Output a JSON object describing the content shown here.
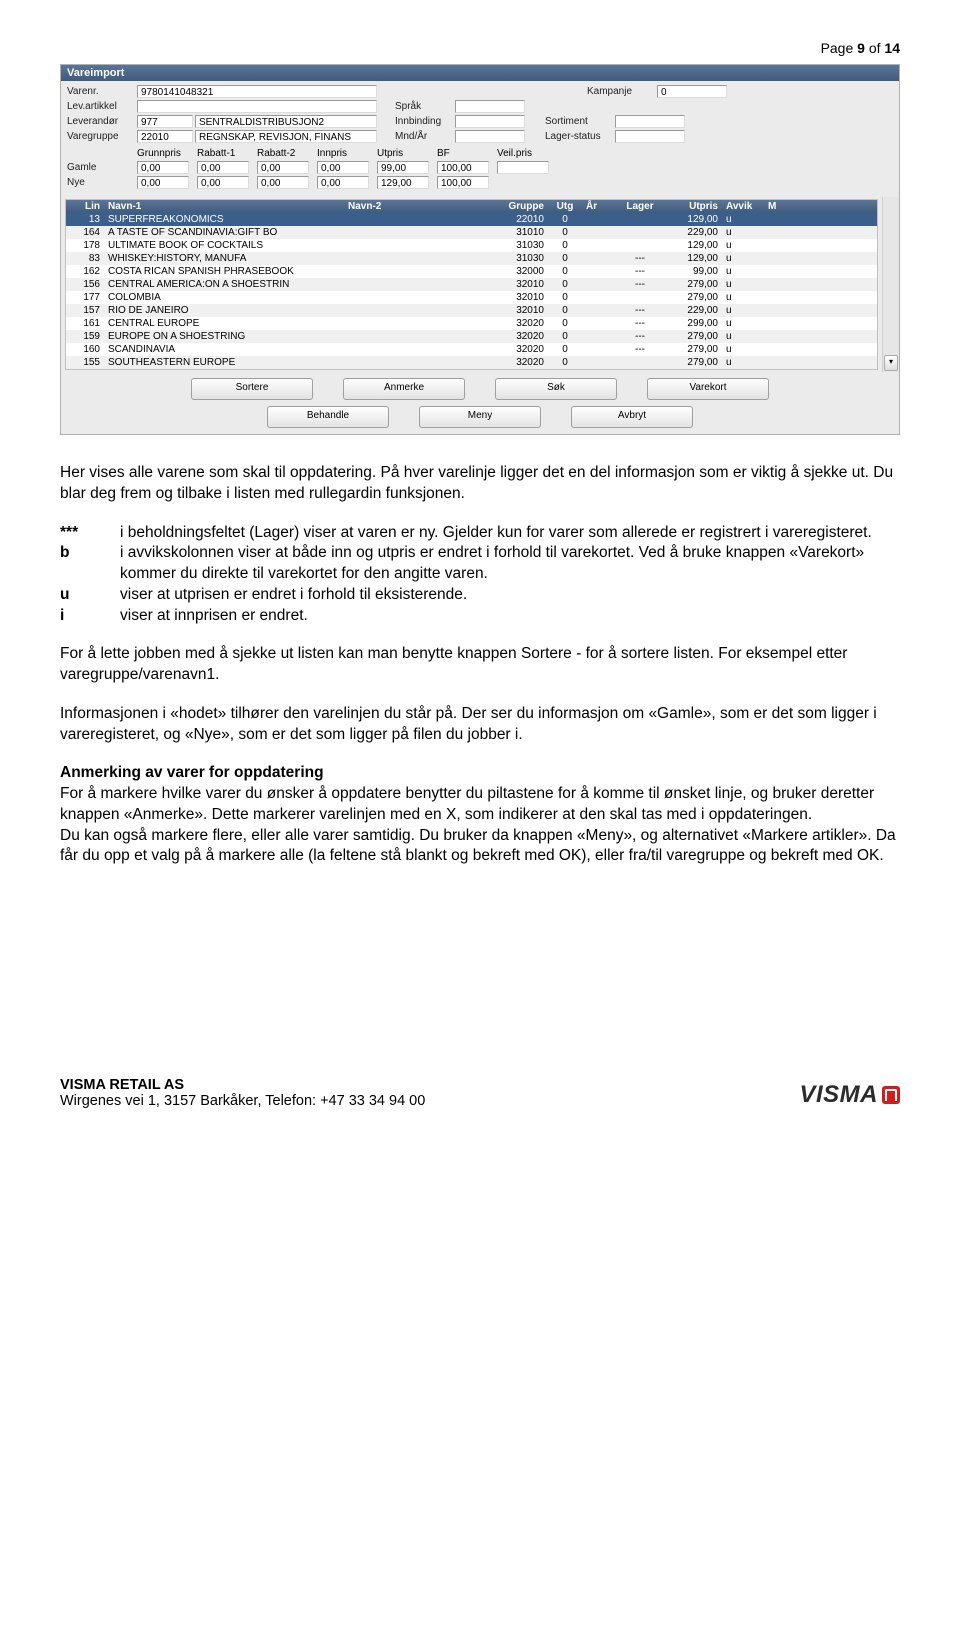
{
  "page_number": {
    "prefix": "Page ",
    "current": "9",
    "of": " of ",
    "total": "14"
  },
  "app": {
    "title": "Vareimport",
    "form": {
      "varenr_lbl": "Varenr.",
      "varenr": "9780141048321",
      "levart_lbl": "Lev.artikkel",
      "levart": "",
      "lever_lbl": "Leverandør",
      "lever_code": "977",
      "lever_name": "SENTRALDISTRIBUSJON2",
      "vgr_lbl": "Varegruppe",
      "vgr_code": "22010",
      "vgr_name": "REGNSKAP, REVISJON, FINANS",
      "sprak_lbl": "Språk",
      "sprak": "",
      "innb_lbl": "Innbinding",
      "innb": "",
      "mndar_lbl": "Mnd/År",
      "mndar": "",
      "kamp_lbl": "Kampanje",
      "kamp": "0",
      "sort_lbl": "Sortiment",
      "sort": "",
      "lager_lbl": "Lager-status",
      "lager": ""
    },
    "price_headers": [
      "Grunnpris",
      "Rabatt-1",
      "Rabatt-2",
      "Innpris",
      "Utpris",
      "BF",
      "Veil.pris"
    ],
    "rows": {
      "gamle_lbl": "Gamle",
      "nye_lbl": "Nye",
      "gamle": [
        "0,00",
        "0,00",
        "0,00",
        "0,00",
        "99,00",
        "100,00",
        ""
      ],
      "nye": [
        "0,00",
        "0,00",
        "0,00",
        "0,00",
        "129,00",
        "100,00"
      ]
    },
    "grid": {
      "headers": [
        "Lin",
        "Navn-1",
        "Navn-2",
        "Gruppe",
        "Utg",
        "År",
        "Lager",
        "Utpris",
        "Avvik",
        "M"
      ],
      "rows": [
        {
          "lin": "13",
          "n1": "SUPERFREAKONOMICS",
          "gr": "22010",
          "utg": "0",
          "lg": "",
          "up": "129,00",
          "av": "u"
        },
        {
          "lin": "164",
          "n1": "A TASTE OF SCANDINAVIA:GIFT BO",
          "gr": "31010",
          "utg": "0",
          "lg": "",
          "up": "229,00",
          "av": "u"
        },
        {
          "lin": "178",
          "n1": "ULTIMATE BOOK OF COCKTAILS",
          "gr": "31030",
          "utg": "0",
          "lg": "",
          "up": "129,00",
          "av": "u"
        },
        {
          "lin": "83",
          "n1": "WHISKEY:HISTORY, MANUFA",
          "gr": "31030",
          "utg": "0",
          "lg": "---",
          "up": "129,00",
          "av": "u"
        },
        {
          "lin": "162",
          "n1": "COSTA RICAN SPANISH PHRASEBOOK",
          "gr": "32000",
          "utg": "0",
          "lg": "---",
          "up": "99,00",
          "av": "u"
        },
        {
          "lin": "156",
          "n1": "CENTRAL AMERICA:ON A SHOESTRIN",
          "gr": "32010",
          "utg": "0",
          "lg": "---",
          "up": "279,00",
          "av": "u"
        },
        {
          "lin": "177",
          "n1": "COLOMBIA",
          "gr": "32010",
          "utg": "0",
          "lg": "",
          "up": "279,00",
          "av": "u"
        },
        {
          "lin": "157",
          "n1": "RIO DE JANEIRO",
          "gr": "32010",
          "utg": "0",
          "lg": "---",
          "up": "229,00",
          "av": "u"
        },
        {
          "lin": "161",
          "n1": "CENTRAL EUROPE",
          "gr": "32020",
          "utg": "0",
          "lg": "---",
          "up": "299,00",
          "av": "u"
        },
        {
          "lin": "159",
          "n1": "EUROPE ON A SHOESTRING",
          "gr": "32020",
          "utg": "0",
          "lg": "---",
          "up": "279,00",
          "av": "u"
        },
        {
          "lin": "160",
          "n1": "SCANDINAVIA",
          "gr": "32020",
          "utg": "0",
          "lg": "---",
          "up": "279,00",
          "av": "u"
        },
        {
          "lin": "155",
          "n1": "SOUTHEASTERN EUROPE",
          "gr": "32020",
          "utg": "0",
          "lg": "",
          "up": "279,00",
          "av": "u"
        }
      ]
    },
    "buttons": {
      "sortere": "Sortere",
      "anmerke": "Anmerke",
      "sok": "Søk",
      "varekort": "Varekort",
      "behandle": "Behandle",
      "meny": "Meny",
      "avbryt": "Avbryt"
    }
  },
  "text": {
    "p1": "Her vises alle varene som skal til oppdatering. På hver varelinje ligger det en del informasjon som er viktig å sjekke ut. Du blar deg frem og tilbake i listen med rullegardin funksjonen.",
    "defs": [
      {
        "k": "***",
        "v": "i beholdningsfeltet (Lager) viser at varen er ny. Gjelder kun for varer som allerede er registrert i vareregisteret."
      },
      {
        "k": "b",
        "v": "i avvikskolonnen  viser at både inn og utpris er endret i forhold til varekortet. Ved å bruke knappen «Varekort» kommer du direkte til varekortet for den angitte varen."
      },
      {
        "k": "u",
        "v": "viser at utprisen er endret i forhold til eksisterende."
      },
      {
        "k": "i",
        "v": "viser at innprisen er endret."
      }
    ],
    "p2": "For å lette jobben med å sjekke ut listen kan man benytte knappen Sortere - for å sortere listen. For eksempel etter varegruppe/varenavn1.",
    "p3": "Informasjonen i «hodet» tilhører den varelinjen du står på. Der ser du informasjon om «Gamle», som er det som ligger i vareregisteret, og «Nye», som er det som ligger på filen du jobber i.",
    "h2": "Anmerking av varer for oppdatering",
    "p4": "For å markere hvilke varer du ønsker å oppdatere benytter du piltastene for å komme til ønsket linje, og bruker deretter knappen «Anmerke». Dette markerer varelinjen med en X, som indikerer at den skal tas med i oppdateringen.",
    "p5": "Du kan også markere flere, eller alle varer samtidig. Du bruker da knappen «Meny», og alternativet «Markere artikler». Da får du opp et valg på å markere alle (la feltene stå blankt og bekreft med OK), eller fra/til varegruppe og bekreft med OK."
  },
  "footer": {
    "company": "VISMA RETAIL AS",
    "address": "Wirgenes vei 1, 3157 Barkåker, Telefon: +47 33 34 94 00",
    "logo": "VISMA"
  }
}
